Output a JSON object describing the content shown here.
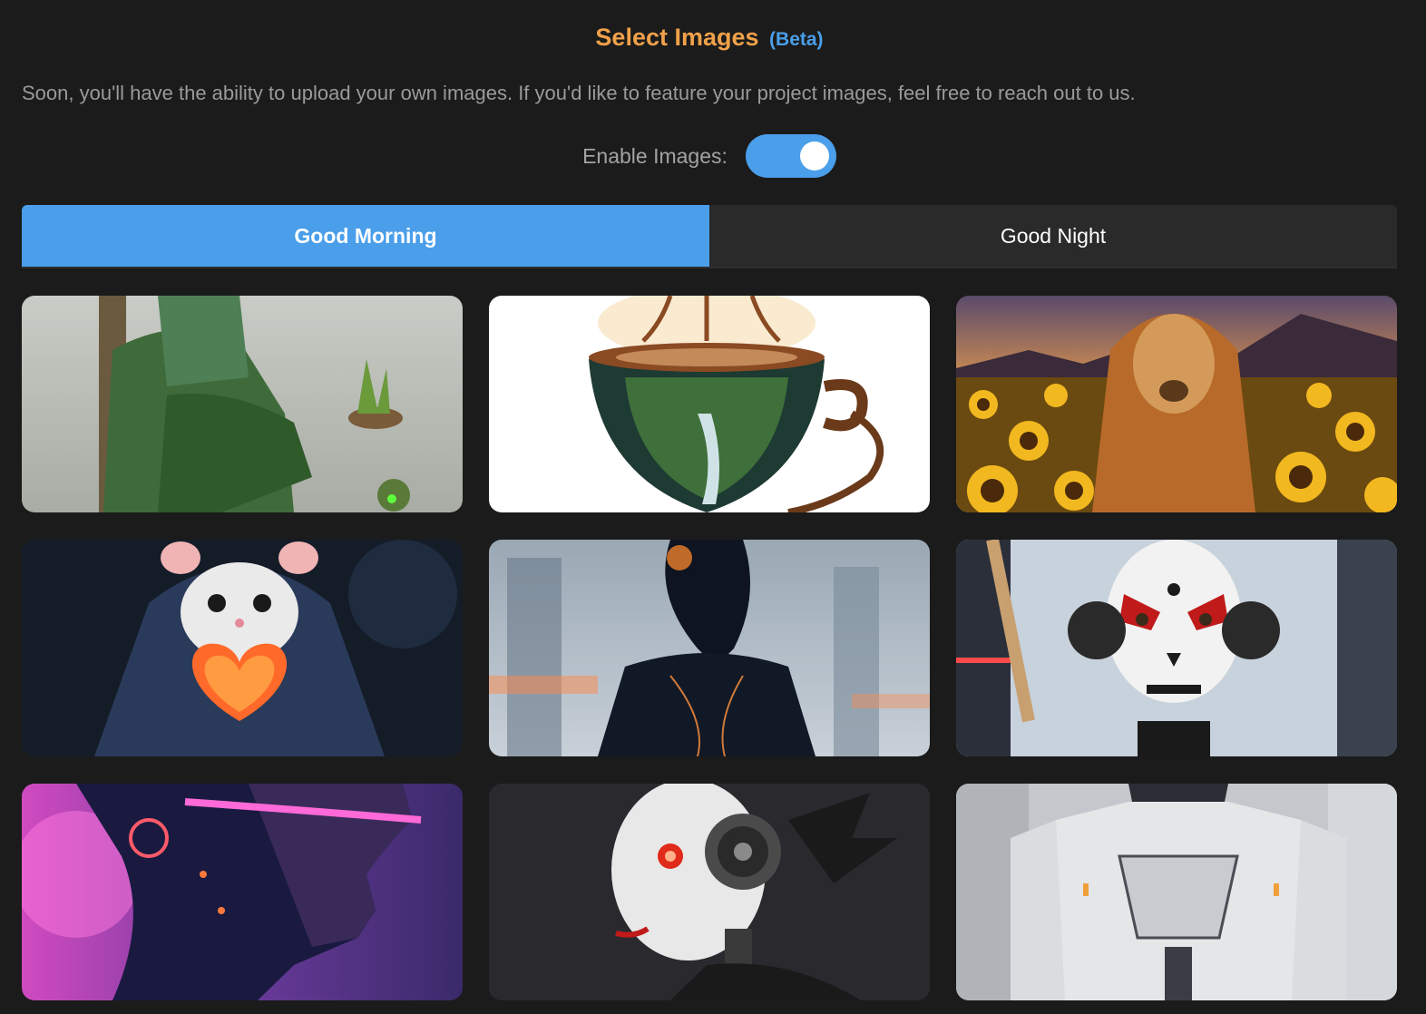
{
  "header": {
    "title": "Select Images",
    "badge": "(Beta)"
  },
  "description": "Soon, you'll have the ability to upload your own images. If you'd like to feature your project images, feel free to reach out to us.",
  "enable_images": {
    "label": "Enable Images:",
    "enabled": true
  },
  "tabs": [
    {
      "label": "Good Morning",
      "active": true
    },
    {
      "label": "Good Night",
      "active": false
    }
  ],
  "colors": {
    "title": "#f0a14a",
    "accent": "#4a9eea",
    "background": "#1b1b1b"
  }
}
